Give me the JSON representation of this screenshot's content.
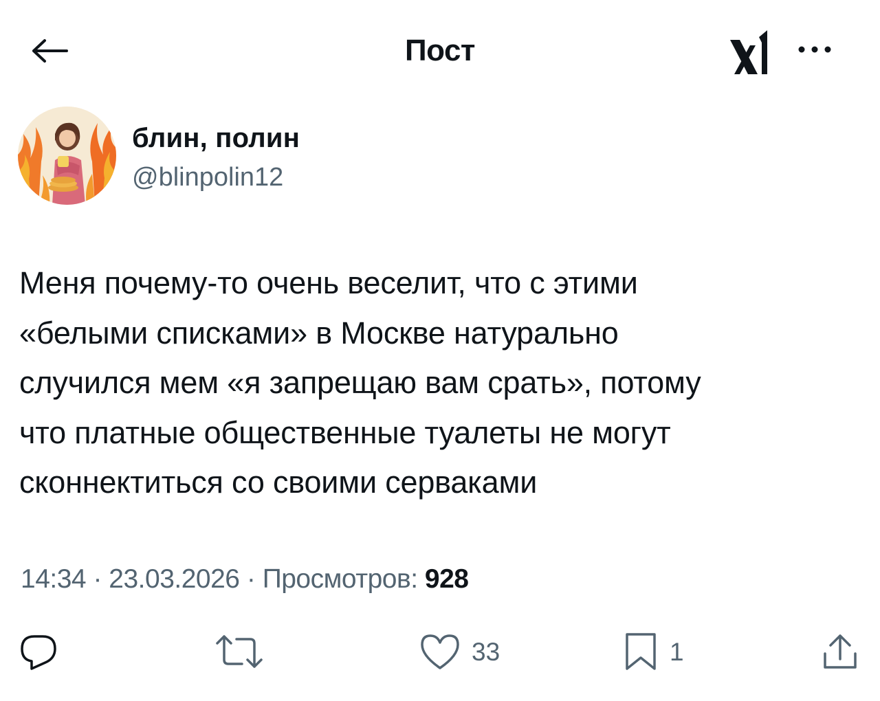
{
  "header": {
    "title": "Пост",
    "back_icon": "arrow-left-icon",
    "logo_icon": "x-logo-icon",
    "more_icon": "more-horizontal-icon"
  },
  "author": {
    "display_name": "блин, полин",
    "handle": "@blinpolin12"
  },
  "tweet": {
    "text": "Меня почему-то очень веселит, что с этими\n«белыми списками» в Москве натурально\nслучился мем «я запрещаю вам срать», потому\nчто платные общественные туалеты не могут\nсконнектиться со своими серваками"
  },
  "meta": {
    "time": "14:34",
    "separator": "·",
    "date": "23.03.2026",
    "views_label": "Просмотров:",
    "views_count": "928"
  },
  "actions": {
    "reply": {
      "icon": "reply-icon"
    },
    "retweet": {
      "icon": "retweet-icon"
    },
    "like": {
      "icon": "heart-icon",
      "count": "33"
    },
    "bookmark": {
      "icon": "bookmark-icon",
      "count": "1"
    },
    "share": {
      "icon": "share-icon"
    }
  },
  "colors": {
    "text": "#0f1419",
    "secondary": "#536471",
    "background": "#ffffff"
  }
}
